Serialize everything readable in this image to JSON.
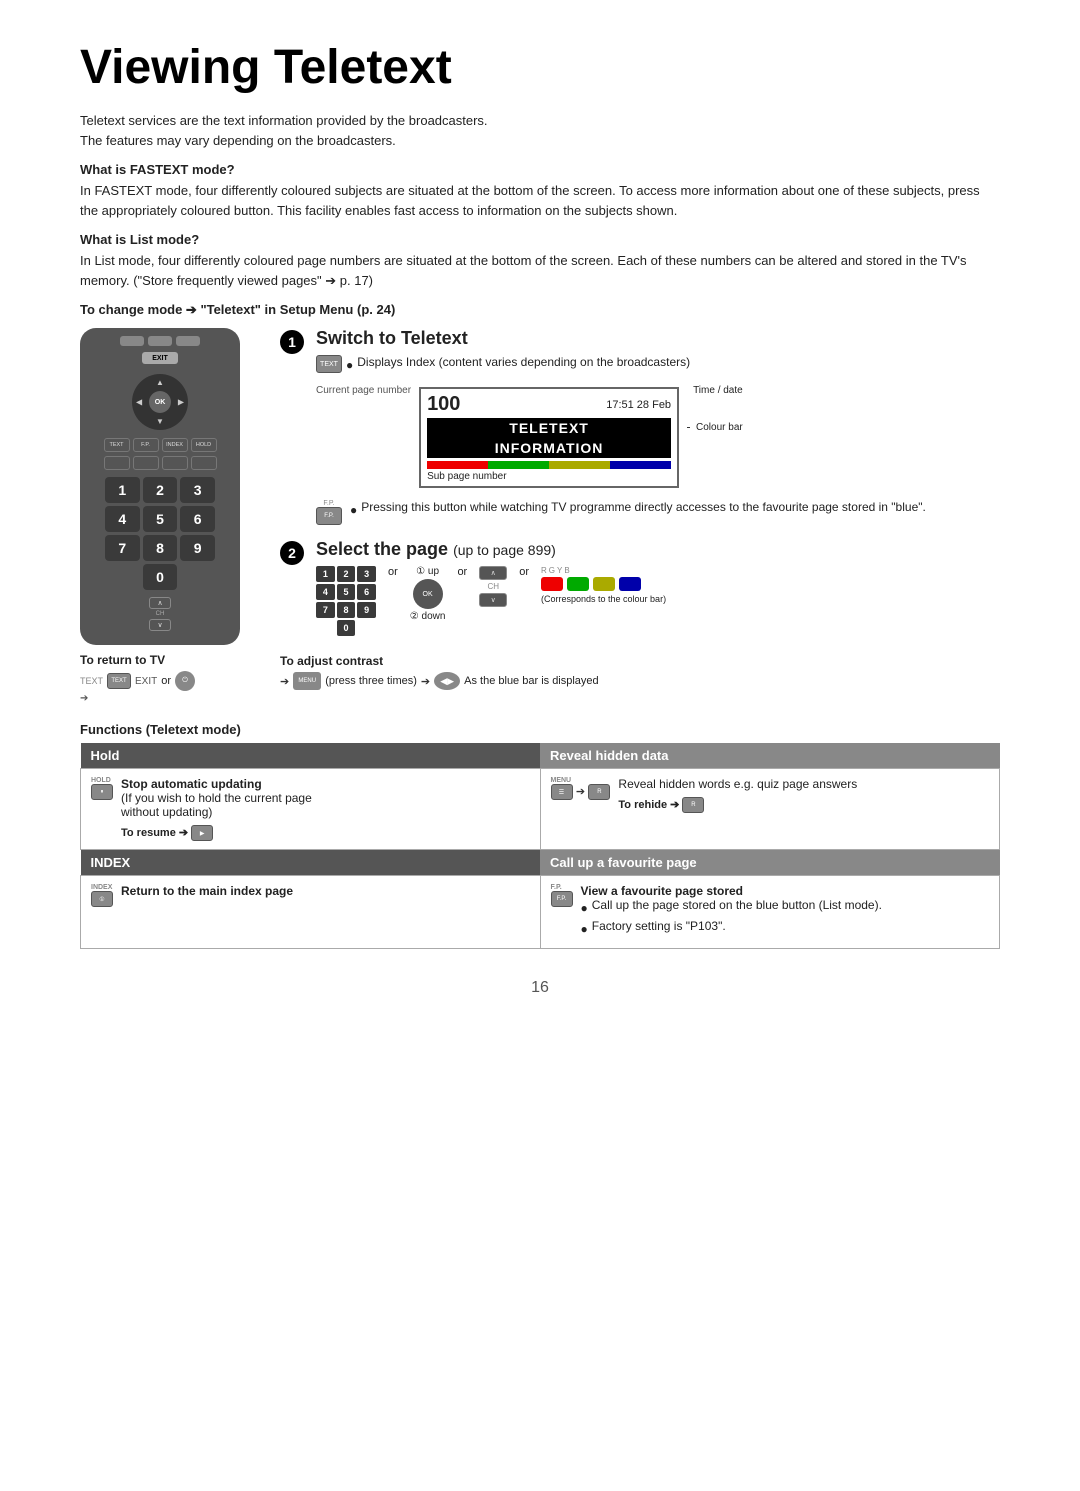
{
  "page": {
    "title": "Viewing Teletext",
    "page_number": "16",
    "intro": [
      "Teletext services are the text information provided by the broadcasters.",
      "The features may vary depending on the broadcasters."
    ],
    "fastext": {
      "heading": "What is FASTEXT mode?",
      "body": "In FASTEXT mode, four differently coloured subjects are situated at the bottom of the screen. To access more information about one of these subjects, press the appropriately coloured button. This facility enables fast access to information on the subjects shown."
    },
    "listmode": {
      "heading": "What is List mode?",
      "body": "In List mode, four differently coloured page numbers are situated at the bottom of the screen. Each of these numbers can be altered and stored in the TV's memory. (\"Store frequently viewed pages\" ➔ p. 17)"
    },
    "change_mode": "To change mode ➔ \"Teletext\" in Setup Menu (p. 24)",
    "step1": {
      "number": "1",
      "title": "Switch to Teletext",
      "bullet": "Displays Index (content varies depending on the broadcasters)"
    },
    "teletext_display": {
      "page_label": "Current page number",
      "page_number": "100",
      "time": "17:51 28 Feb",
      "time_label": "Time / date",
      "line1": "TELETEXT",
      "line2": "INFORMATION",
      "colour_bar_label": "Colour bar",
      "sub_page_label": "Sub page number"
    },
    "fp_text": "Pressing this button while watching TV programme directly accesses to the favourite page stored in \"blue\".",
    "step2": {
      "number": "2",
      "title": "Select the page",
      "subtitle": "(up to page 899)",
      "up_label": "① up",
      "down_label": "② down",
      "colour_note": "(Corresponds to the colour bar)"
    },
    "return_tv": {
      "label": "To return to TV"
    },
    "adjust_contrast": {
      "label": "To adjust contrast",
      "desc": "(press three times)",
      "desc2": "As the blue bar is displayed"
    },
    "functions_title": "Functions (Teletext mode)",
    "hold_section": {
      "header": "Hold",
      "icon_label": "HOLD",
      "button_label": "Stop automatic updating",
      "desc1": "(If you wish to hold the current page",
      "desc2": "without updating)",
      "resume_label": "To resume ➔"
    },
    "reveal_section": {
      "header": "Reveal hidden data",
      "desc": "Reveal hidden words e.g. quiz page answers",
      "rehide_label": "To rehide ➔"
    },
    "index_section": {
      "header": "INDEX",
      "icon_label": "INDEX",
      "button_label": "Return to the main index page"
    },
    "callup_section": {
      "header": "Call up a favourite page",
      "icon_label": "F.P.",
      "button_label": "View a favourite page stored",
      "bullet1": "Call up the page stored on the blue button (List mode).",
      "bullet2": "Factory setting is \"P103\"."
    }
  }
}
